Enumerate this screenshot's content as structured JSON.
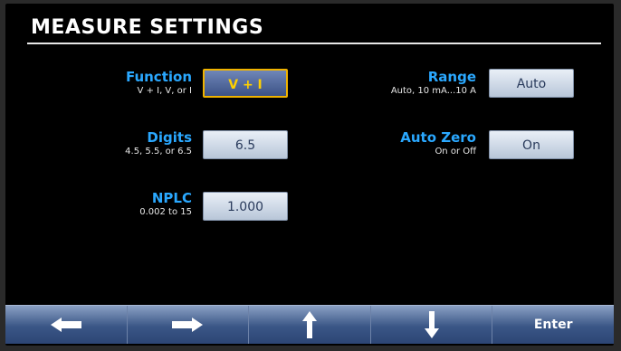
{
  "header": {
    "title": "MEASURE SETTINGS"
  },
  "settings": {
    "function": {
      "label": "Function",
      "hint": "V + I, V, or I",
      "value": "V + I"
    },
    "digits": {
      "label": "Digits",
      "hint": "4.5, 5.5, or 6.5",
      "value": "6.5"
    },
    "nplc": {
      "label": "NPLC",
      "hint": "0.002 to 15",
      "value": "1.000"
    },
    "range": {
      "label": "Range",
      "hint": "Auto, 10 mA...10 A",
      "value": "Auto"
    },
    "auto_zero": {
      "label": "Auto Zero",
      "hint": "On or Off",
      "value": "On"
    }
  },
  "navbar": {
    "left_icon": "arrow-left-icon",
    "right_icon": "arrow-right-icon",
    "up_icon": "arrow-up-icon",
    "down_icon": "arrow-down-icon",
    "enter_label": "Enter"
  },
  "colors": {
    "label_accent": "#2aa8ff",
    "selected_border": "#f0b300",
    "selected_text": "#ffd000"
  }
}
